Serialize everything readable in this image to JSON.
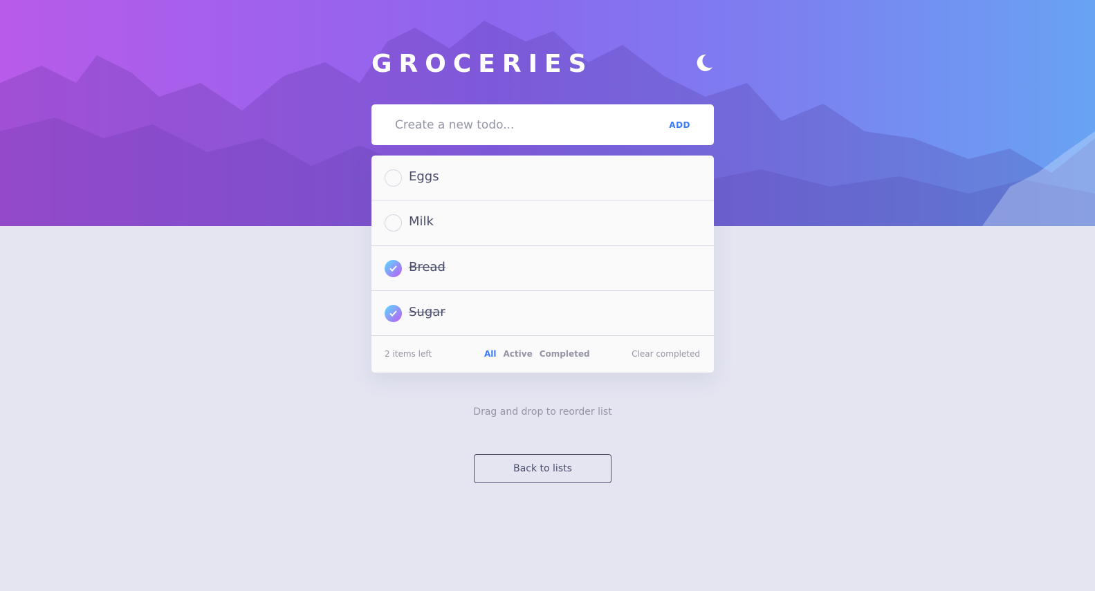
{
  "app": {
    "title": "GROCERIES",
    "theme_icon": "moon-icon"
  },
  "new_todo": {
    "placeholder": "Create a new todo...",
    "add_label": "ADD"
  },
  "todos": [
    {
      "text": "Eggs",
      "completed": false
    },
    {
      "text": "Milk",
      "completed": false
    },
    {
      "text": "Bread",
      "completed": true
    },
    {
      "text": "Sugar",
      "completed": true
    }
  ],
  "footer": {
    "items_left": "2 items left",
    "filters": [
      {
        "label": "All",
        "active": true
      },
      {
        "label": "Active",
        "active": false
      },
      {
        "label": "Completed",
        "active": false
      }
    ],
    "clear_label": "Clear completed"
  },
  "hint": "Drag and drop to reorder list",
  "back_label": "Back to lists",
  "colors": {
    "accent": "#3a7bfd",
    "check_gradient_start": "#57ddff",
    "check_gradient_end": "#c058f3",
    "page_background": "#e4e5f1",
    "text": "#494c6b",
    "muted_text": "#9495a5"
  }
}
